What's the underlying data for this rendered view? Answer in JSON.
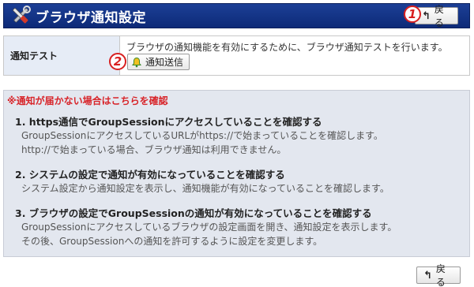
{
  "header": {
    "title": "ブラウザ通知設定",
    "back_label": "戻る"
  },
  "annotations": {
    "num1": "1",
    "num2": "2"
  },
  "test": {
    "label": "通知テスト",
    "description": "ブラウザの通知機能を有効にするために、ブラウザ通知テストを行います。",
    "send_label": "通知送信"
  },
  "guide": {
    "header": "※通知が届かない場合はこちらを確認",
    "steps": [
      {
        "title": "1.  https通信でGroupSessionにアクセスしていることを確認する",
        "lines": [
          "GroupSessionにアクセスしているURLがhttps://で始まっていることを確認します。",
          "http://で始まっている場合、ブラウザ通知は利用できません。"
        ]
      },
      {
        "title": "2.  システムの設定で通知が有効になっていることを確認する",
        "lines": [
          "システム設定から通知設定を表示し、通知機能が有効になっていることを確認します。"
        ]
      },
      {
        "title": "3.  ブラウザの設定でGroupSessionの通知が有効になっていることを確認する",
        "lines": [
          "GroupSessionにアクセスしているブラウザの設定画面を開き、通知設定を表示します。",
          "その後、GroupSessionへの通知を許可するように設定を変更します。"
        ]
      }
    ]
  },
  "footer": {
    "back_label": "戻る"
  },
  "colors": {
    "header_bg": "#1c3f96",
    "warning_text": "#d8252a",
    "label_bg": "#e6ecf6",
    "guide_bg": "#e3e7ef",
    "annotation": "#d82020"
  },
  "icons": {
    "header": "tools-icon",
    "back": "back-arrow-icon",
    "send": "bell-icon"
  }
}
